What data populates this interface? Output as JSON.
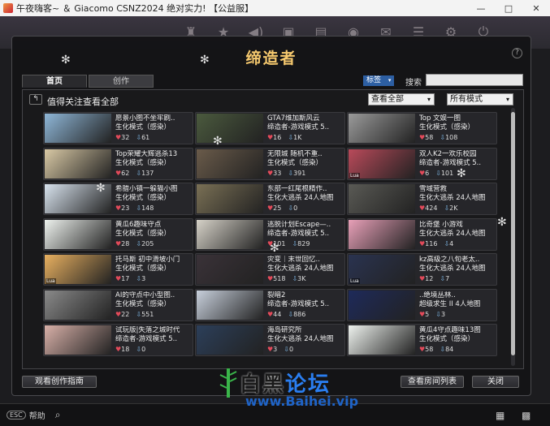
{
  "window": {
    "title": "午夜嗨客~ ＆ Giacomo CSNZ2024 绝对实力! 【公益服】",
    "buttons": [
      "—",
      "□",
      "✕"
    ]
  },
  "dialog": {
    "title": "缔造者",
    "help": "?",
    "tabs": [
      {
        "label": "首页",
        "active": true
      },
      {
        "label": "创作",
        "active": false
      }
    ],
    "tag_button": "标签",
    "search_label": "搜索",
    "search_value": "",
    "back_label": "↰",
    "section_title": "值得关注查看全部",
    "filter1": "查看全部",
    "filter2": "所有模式",
    "guide_button": "观看创作指南",
    "room_list_button": "查看房间列表",
    "close_button": "关闭"
  },
  "cards": [
    {
      "title": "愿景小图不坐牢刷..",
      "sub": "生化模式（感染）",
      "likes": "32",
      "downloads": "61",
      "lua": false,
      "color": "#8fb7d8"
    },
    {
      "title": "GTA7维加斯风云",
      "sub": "缔造者-游戏模式 5..",
      "likes": "16",
      "downloads": "1K",
      "lua": false,
      "color": "#4b5a3e"
    },
    {
      "title": "Top  文娱一图",
      "sub": "生化模式（感染）",
      "likes": "58",
      "downloads": "108",
      "lua": false,
      "color": "#9a9a9a"
    },
    {
      "title": "Top荣耀大辉逃杀13",
      "sub": "生化模式（感染）",
      "likes": "62",
      "downloads": "137",
      "lua": false,
      "color": "#d9c9a5"
    },
    {
      "title": "无限城  随机不重..",
      "sub": "生化模式（感染）",
      "likes": "33",
      "downloads": "391",
      "lua": false,
      "color": "#6a5b4a"
    },
    {
      "title": "双人K2一欢乐校园",
      "sub": "缔造者-游戏模式 5..",
      "likes": "6",
      "downloads": "101",
      "lua": true,
      "color": "#b94a5a"
    },
    {
      "title": "希腊小镇一躲猫小图",
      "sub": "生化模式（感染）",
      "likes": "23",
      "downloads": "148",
      "lua": false,
      "color": "#d8e3ee"
    },
    {
      "title": "东部一红尾根精作..",
      "sub": "生化大逃杀 24人地图",
      "likes": "25",
      "downloads": "0",
      "lua": false,
      "color": "#7a7055"
    },
    {
      "title": "雪域营救",
      "sub": "生化大逃杀 24人地图",
      "likes": "424",
      "downloads": "2K",
      "lua": false,
      "color": "#5a5a55"
    },
    {
      "title": "黄瓜6趣味守点",
      "sub": "生化模式（感染）",
      "likes": "28",
      "downloads": "205",
      "lua": false,
      "color": "#eef2ee"
    },
    {
      "title": "逃脱计划Escape—..",
      "sub": "缔造者-游戏模式 5..",
      "likes": "101",
      "downloads": "829",
      "lua": false,
      "color": "#d6d2c8"
    },
    {
      "title": "比奇堡  小游戏",
      "sub": "生化大逃杀 24人地图",
      "likes": "116",
      "downloads": "4",
      "lua": false,
      "color": "#e8a0b8"
    },
    {
      "title": "托马斯  初中滑坡小门",
      "sub": "生化模式（感染）",
      "likes": "17",
      "downloads": "3",
      "lua": true,
      "color": "#e8b060"
    },
    {
      "title": "灾变｜末世回忆..",
      "sub": "生化大逃杀 24人地图",
      "likes": "518",
      "downloads": "3K",
      "lua": false,
      "color": "#3a3238"
    },
    {
      "title": "kz高级之八旬老太..",
      "sub": "生化大逃杀 24人地图",
      "likes": "12",
      "downloads": "7",
      "lua": true,
      "color": "#2a3350"
    },
    {
      "title": "AI的守点中小型图..",
      "sub": "生化模式（感染）",
      "likes": "22",
      "downloads": "551",
      "lua": false,
      "color": "#8a8a8a"
    },
    {
      "title": "裂暗2",
      "sub": "缔造者-游戏模式 5..",
      "likes": "44",
      "downloads": "886",
      "lua": false,
      "color": "#c8d0dc"
    },
    {
      "title": "..绝境丛林..",
      "sub": "超级求生 II  4人地图",
      "likes": "5",
      "downloads": "3",
      "lua": false,
      "color": "#1e2a5a"
    },
    {
      "title": "试玩版|失落之城时代",
      "sub": "缔造者-游戏模式 5..",
      "likes": "18",
      "downloads": "0",
      "lua": false,
      "color": "#d8b0a8"
    },
    {
      "title": "海岛研究所",
      "sub": "生化大逃杀 24人地图",
      "likes": "3",
      "downloads": "0",
      "lua": false,
      "color": "#2c3f5a"
    },
    {
      "title": "黄瓜4守点趣味13图",
      "sub": "生化模式（感染）",
      "likes": "58",
      "downloads": "84",
      "lua": false,
      "color": "#eef2ee"
    }
  ],
  "bottom": {
    "key": "ESC",
    "help_label": "帮助"
  },
  "watermark": {
    "text1": "白黑",
    "text2": "论坛",
    "url": "www.Baihei.vip"
  },
  "hud_icons": [
    "trophy-icon",
    "star-icon",
    "sound-icon",
    "tv-icon",
    "bag-icon",
    "controller-icon",
    "mail-icon",
    "menu-icon",
    "gear-icon",
    "power-icon"
  ]
}
